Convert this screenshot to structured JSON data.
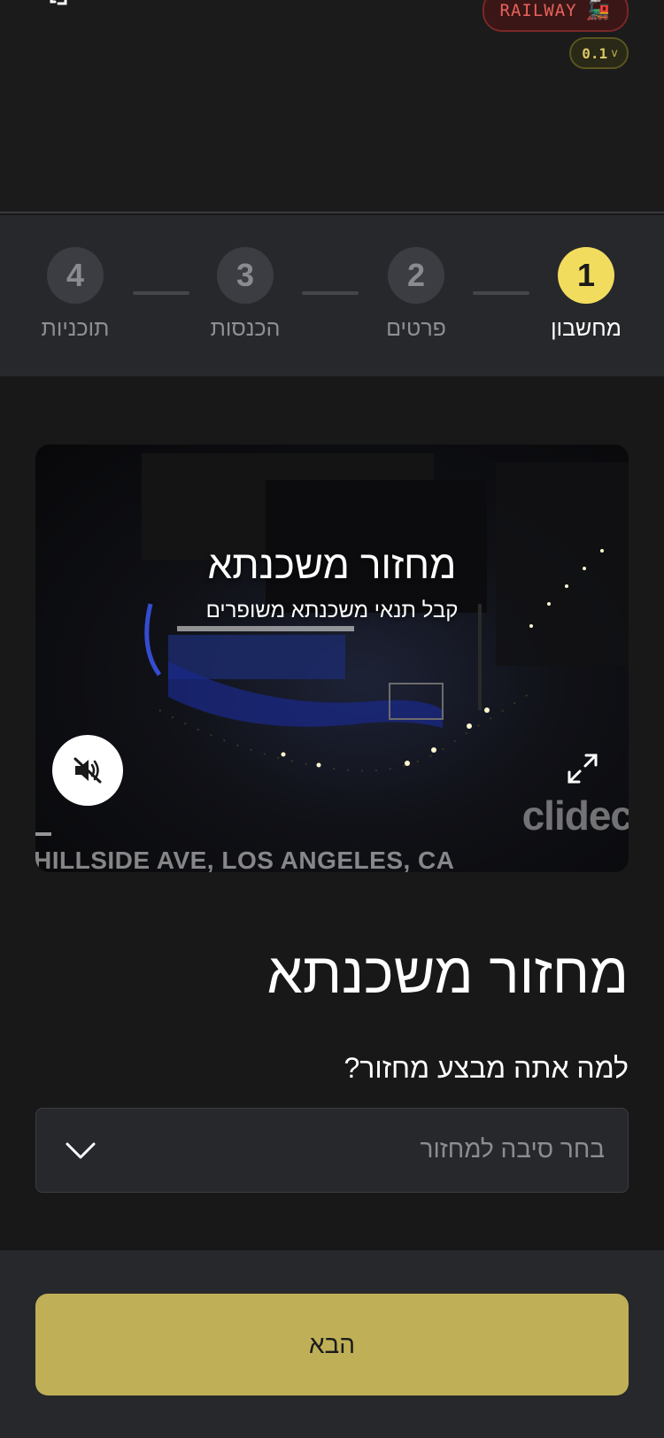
{
  "header": {
    "badge_label": "RAILWAY",
    "badge_icon": "train-icon",
    "version": "0.1",
    "logout_icon": "logout-icon"
  },
  "stepper": {
    "steps": [
      {
        "number": "1",
        "label": "מחשבון",
        "state": "active"
      },
      {
        "number": "2",
        "label": "פרטים",
        "state": "inactive"
      },
      {
        "number": "3",
        "label": "הכנסות",
        "state": "inactive"
      },
      {
        "number": "4",
        "label": "תוכניות",
        "state": "inactive"
      }
    ],
    "active_color": "#f1dc5e"
  },
  "video": {
    "title": "מחזור משכנתא",
    "subtitle": "קבל תנאי משכנתא משופרים",
    "watermark": "clidec",
    "address_overlay": "HILLSIDE AVE, LOS ANGELES, CA",
    "mute_icon": "speaker-muted-icon",
    "expand_icon": "expand-icon"
  },
  "form": {
    "title": "מחזור משכנתא",
    "question": "למה אתה מבצע מחזור?",
    "select_placeholder": "בחר סיבה למחזור",
    "select_icon": "chevron-down-icon"
  },
  "footer": {
    "next_label": "הבא",
    "next_color": "#bfb057"
  }
}
